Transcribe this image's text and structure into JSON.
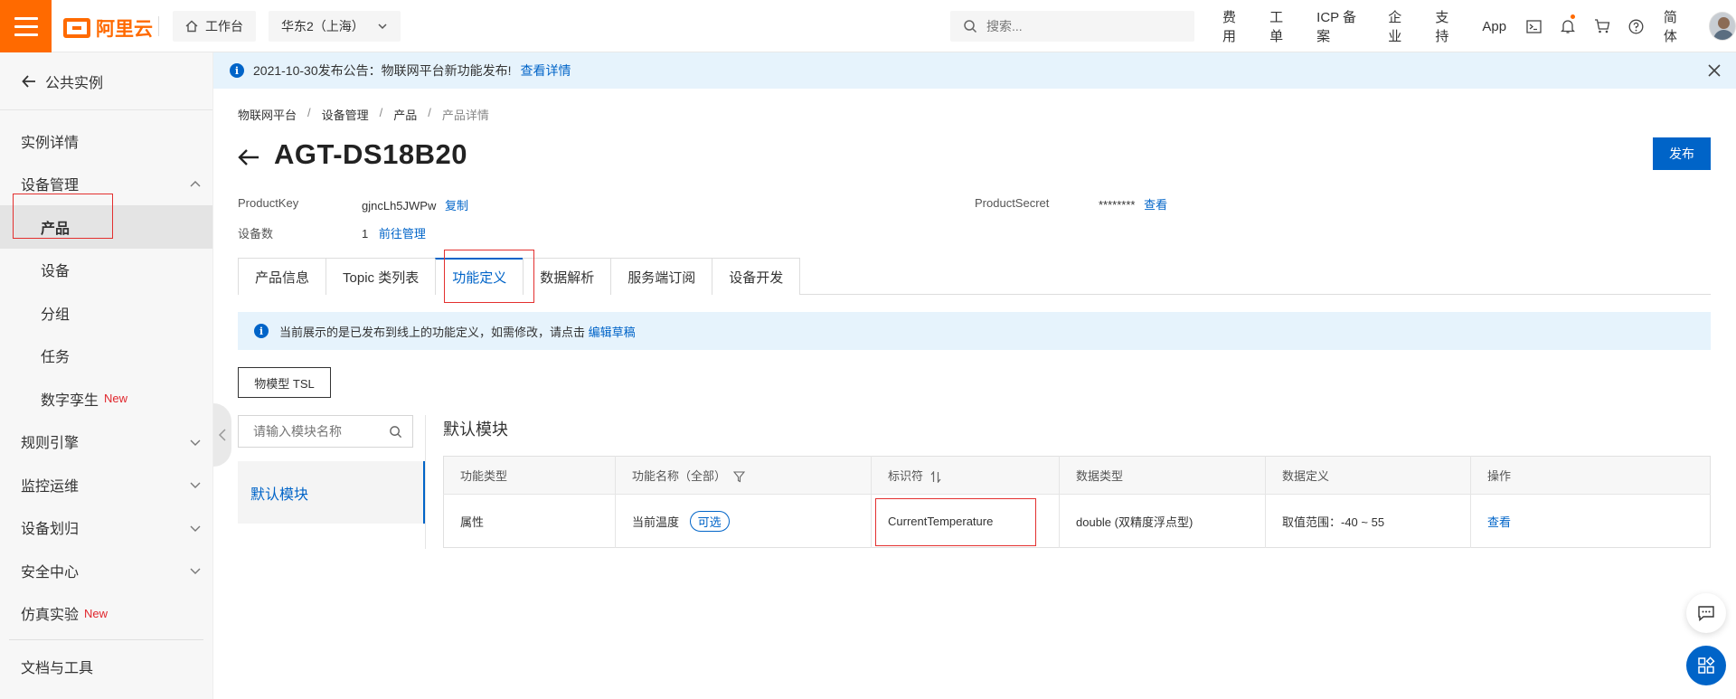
{
  "topbar": {
    "logo_text": "阿里云",
    "workbench_label": "工作台",
    "region_label": "华东2（上海）",
    "search_placeholder": "搜索...",
    "links": [
      "费用",
      "工单",
      "ICP 备案",
      "企业",
      "支持",
      "App"
    ],
    "lang_label": "简体"
  },
  "sidebar": {
    "back_label": "公共实例",
    "items": [
      {
        "label": "实例详情"
      },
      {
        "label": "设备管理"
      },
      {
        "label": "产品"
      },
      {
        "label": "设备"
      },
      {
        "label": "分组"
      },
      {
        "label": "任务"
      },
      {
        "label": "数字孪生",
        "tag": "New"
      },
      {
        "label": "规则引擎"
      },
      {
        "label": "监控运维"
      },
      {
        "label": "设备划归"
      },
      {
        "label": "安全中心"
      },
      {
        "label": "仿真实验",
        "tag": "New"
      },
      {
        "label": "文档与工具"
      }
    ]
  },
  "notice": {
    "text": "2021-10-30发布公告：物联网平台新功能发布!",
    "link": "查看详情"
  },
  "breadcrumb": [
    "物联网平台",
    "设备管理",
    "产品",
    "产品详情"
  ],
  "product": {
    "title": "AGT-DS18B20",
    "publish_label": "发布",
    "key_label": "ProductKey",
    "key_value": "gjncLh5JWPw",
    "copy_label": "复制",
    "secret_label": "ProductSecret",
    "secret_value": "********",
    "view_label": "查看",
    "device_count_label": "设备数",
    "device_count_value": "1",
    "manage_label": "前往管理"
  },
  "tabs": [
    "产品信息",
    "Topic 类列表",
    "功能定义",
    "数据解析",
    "服务端订阅",
    "设备开发"
  ],
  "active_tab": "功能定义",
  "tip": {
    "text": "当前展示的是已发布到线上的功能定义，如需修改，请点击",
    "link": "编辑草稿"
  },
  "tsl_button": "物模型 TSL",
  "module_search_placeholder": "请输入模块名称",
  "modules": [
    "默认模块"
  ],
  "section_title": "默认模块",
  "table": {
    "headers": [
      "功能类型",
      "功能名称（全部）",
      "标识符",
      "数据类型",
      "数据定义",
      "操作"
    ],
    "rows": [
      {
        "type": "属性",
        "name": "当前温度",
        "name_tag": "可选",
        "identifier": "CurrentTemperature",
        "data_type": "double (双精度浮点型)",
        "definition": "取值范围：-40 ~ 55",
        "action": "查看"
      }
    ]
  },
  "colors": {
    "brand": "#ff6a00",
    "primary": "#0064c8",
    "highlight": "#e3302f",
    "new_tag": "#e0262c"
  }
}
